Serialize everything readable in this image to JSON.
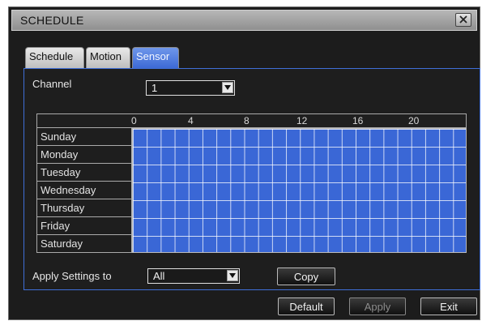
{
  "window": {
    "title": "SCHEDULE"
  },
  "tabs": [
    {
      "label": "Schedule",
      "active": false
    },
    {
      "label": "Motion",
      "active": false
    },
    {
      "label": "Sensor",
      "active": true
    }
  ],
  "channel": {
    "label": "Channel",
    "value": "1"
  },
  "schedule": {
    "hours": [
      "0",
      "4",
      "8",
      "12",
      "16",
      "20"
    ],
    "days": [
      "Sunday",
      "Monday",
      "Tuesday",
      "Wednesday",
      "Thursday",
      "Friday",
      "Saturday"
    ],
    "all_hours_selected": true
  },
  "apply": {
    "label": "Apply Settings to",
    "value": "All",
    "copy_label": "Copy"
  },
  "footer": {
    "default_label": "Default",
    "apply_label": "Apply",
    "exit_label": "Exit"
  },
  "colors": {
    "accent": "#3a67d6",
    "window_bg": "#1c1c1c"
  },
  "icons": {
    "close": "close-icon",
    "dropdown": "chevron-down-icon"
  }
}
